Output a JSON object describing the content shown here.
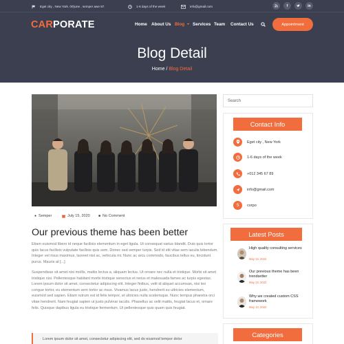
{
  "topbar": {
    "address": "Eget city , New York. 00'june , semper awe 87.",
    "hours": "1-6 days of the week",
    "email": "info@gmail.com",
    "social": [
      "rss-icon",
      "facebook-icon",
      "twitter-icon",
      "linkedin-icon"
    ]
  },
  "logo": {
    "accent": "CAR",
    "rest": "PORATE"
  },
  "nav": {
    "home": "Home",
    "about": "About Us",
    "blog": "Blog",
    "services": "Services",
    "team": "Team",
    "contact": "Contact Us"
  },
  "appointment_label": "Appointment",
  "hero": {
    "title": "Blog Detail",
    "crumb_home": "Home",
    "crumb_sep": "/",
    "crumb_current": "Blog Detail"
  },
  "post": {
    "author": "Semper",
    "date": "July 15, 2020",
    "comments": "No Comment",
    "title": "Our previous theme has been better",
    "para1": "Etiam euismod libero id neque facilisis elementum in eget ligula. Ut consequat varius blandit. Duis quis tortor quis lacus facilisis vulputate facilisis quis sem. Donec sed semper turpis. Sed id elit vitae sem iaculis bibendum. Integer vel risus maximus, laoreet nisl ac, vehicula mi. Nunc ac arcu commodo, faucibus tellus eu, tincidunt purus. Mauris at [...]",
    "para2": "Suspendisse sit amet nisi mollis, mattis lectus a, aliquam lectus. Ut ornare nec nulla et tristique. Morbi sit amet tristique nisi. Pellentesque habitant morbi tristique senectus et netus et malesuada fames ac turpis egestas. Lorem ipsum dolor sit amet, consectetur adipiscing elit. Integer finibus, velit id aliquet accumsan, nisi leo congue tortor, eu elementum sem tortor ac risus. Vivamus lacus justo, hendrerit eu ultricies elementum, euismod sed sapien. Etiam rutrum est id felis tempor, et ultricies nulla scelerisque. Nunc tempus pharetra orci vitae hendrerit. Nam feugiat sapien ut justo pulvinar iaculis. Phasellus ac velit mattis, feugiat lacus et, ornare felis. Quisque dapibus ligula eu tristique fermentum. Ut pellentesque quis quam quis feugiat.",
    "quote": "Lorem ipsum dolor sit amet, consectetur adipiscing elit, sed do eiusmod tempor dolor"
  },
  "sidebar": {
    "search_placeholder": "Search",
    "contact_title": "Contact Info",
    "contact": [
      {
        "icon": "map-pin-icon",
        "text": "Eget city , New York"
      },
      {
        "icon": "clock-icon",
        "text": "1-6 days of the week"
      },
      {
        "icon": "phone-icon",
        "text": "+012 345 67 89"
      },
      {
        "icon": "send-icon",
        "text": "info@gmail.com"
      },
      {
        "icon": "skype-icon",
        "text": "corpo"
      }
    ],
    "latest_title": "Latest Posts",
    "latest": [
      {
        "title": "High quality consulting services",
        "date": "May 13, 2022"
      },
      {
        "title": "Our previous theme has been trendsetter",
        "date": "May 13, 2022"
      },
      {
        "title": "Why we created custom CSS framework",
        "date": "May 13, 2022"
      }
    ],
    "categories_title": "Categories"
  },
  "colors": {
    "accent": "#f26d3d",
    "header_bg": "#3b3f50"
  }
}
